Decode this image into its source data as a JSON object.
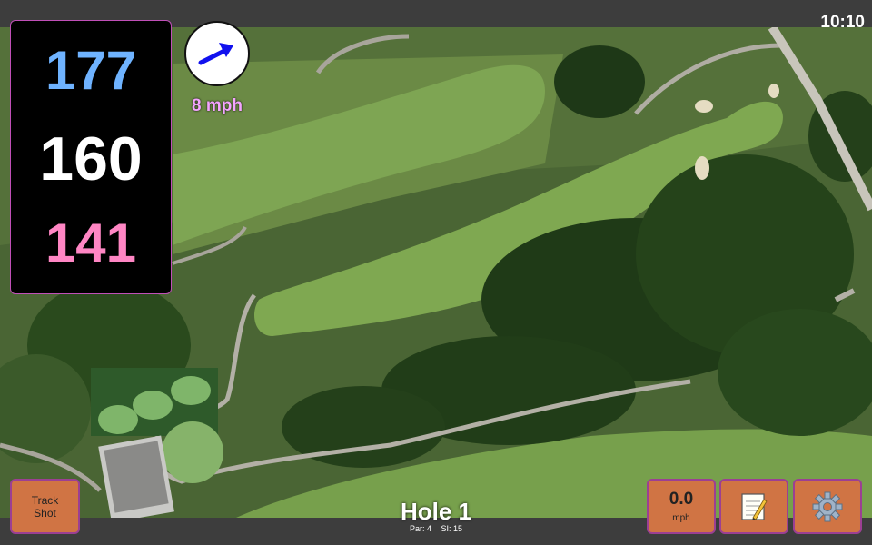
{
  "status": {
    "clock": "10:10"
  },
  "yardage": {
    "back": "177",
    "middle": "160",
    "front": "141"
  },
  "wind": {
    "speed": "8 mph",
    "icon": "wind-arrow-icon",
    "arrow_color": "#1111ee"
  },
  "hole": {
    "title": "Hole 1",
    "par": "Par: 4",
    "stroke_index": "SI: 15"
  },
  "buttons": {
    "track_shot": "Track\nShot",
    "speed_value": "0.0",
    "speed_unit": "mph",
    "notes_icon": "notepad-icon",
    "settings_icon": "gear-icon"
  },
  "colors": {
    "button_bg": "#d07444",
    "button_border": "#9c3f93",
    "back_yardage": "#6fb3ff",
    "front_yardage": "#ff86c4",
    "wind_text": "#f4a4ff"
  }
}
